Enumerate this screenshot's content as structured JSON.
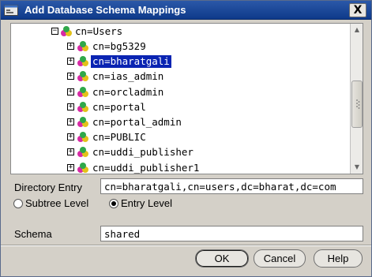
{
  "window": {
    "title": "Add Database Schema Mappings",
    "close_label": "X",
    "icon": "dialog-app-icon"
  },
  "tree": {
    "root": {
      "label": "cn=Users",
      "expanded": true,
      "icon": "folder-node-icon"
    },
    "children": [
      {
        "label": "cn=bg5329",
        "selected": false
      },
      {
        "label": "cn=bharatgali",
        "selected": true
      },
      {
        "label": "cn=ias_admin",
        "selected": false
      },
      {
        "label": "cn=orcladmin",
        "selected": false
      },
      {
        "label": "cn=portal",
        "selected": false
      },
      {
        "label": "cn=portal_admin",
        "selected": false
      },
      {
        "label": "cn=PUBLIC",
        "selected": false
      },
      {
        "label": "cn=uddi_publisher",
        "selected": false
      },
      {
        "label": "cn=uddi_publisher1",
        "selected": false
      }
    ]
  },
  "form": {
    "directory_entry_label": "Directory Entry",
    "directory_entry_value": "cn=bharatgali,cn=users,dc=bharat,dc=com",
    "subtree_level_label": "Subtree Level",
    "entry_level_label": "Entry Level",
    "selected_level": "entry",
    "schema_label": "Schema",
    "schema_value": "shared"
  },
  "buttons": {
    "ok": "OK",
    "cancel": "Cancel",
    "help": "Help"
  },
  "colors": {
    "title_bar": "#1c4a9c",
    "selection": "#0a24b2",
    "dialog_bg": "#d4d0c8"
  }
}
